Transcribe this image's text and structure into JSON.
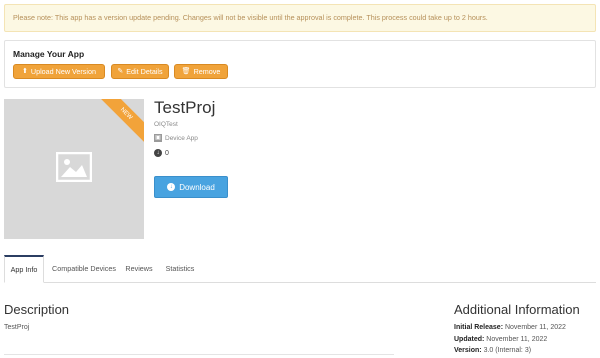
{
  "notice": {
    "text": "Please note: This app has a version update pending. Changes will not be visible until the approval is complete. This process could take up to 2 hours."
  },
  "manage": {
    "title": "Manage Your App",
    "buttons": [
      {
        "label": "Upload New Version",
        "icon": "upload-icon"
      },
      {
        "label": "Edit Details",
        "icon": "edit-icon"
      },
      {
        "label": "Remove",
        "icon": "trash-icon"
      }
    ]
  },
  "app": {
    "ribbon": "NEW",
    "title": "TestProj",
    "company": "OIQTest",
    "type": "Device App",
    "downloads": "0",
    "download_button": "Download"
  },
  "tabs": [
    "App Info",
    "Compatible Devices",
    "Reviews",
    "Statistics"
  ],
  "description": {
    "heading": "Description",
    "text": "TestProj"
  },
  "additional": {
    "heading": "Additional Information",
    "rows": [
      {
        "label": "Initial Release:",
        "value": "November 11, 2022"
      },
      {
        "label": "Updated:",
        "value": "November 11, 2022"
      },
      {
        "label": "Version:",
        "value": "3.0 (Internal: 3)"
      }
    ]
  },
  "colors": {
    "accent_orange": "#f0a33a",
    "download_blue": "#48a3e0",
    "notice_bg": "#fcf8e3",
    "notice_text": "#b6905a",
    "active_tab_border": "#2b3d62"
  }
}
